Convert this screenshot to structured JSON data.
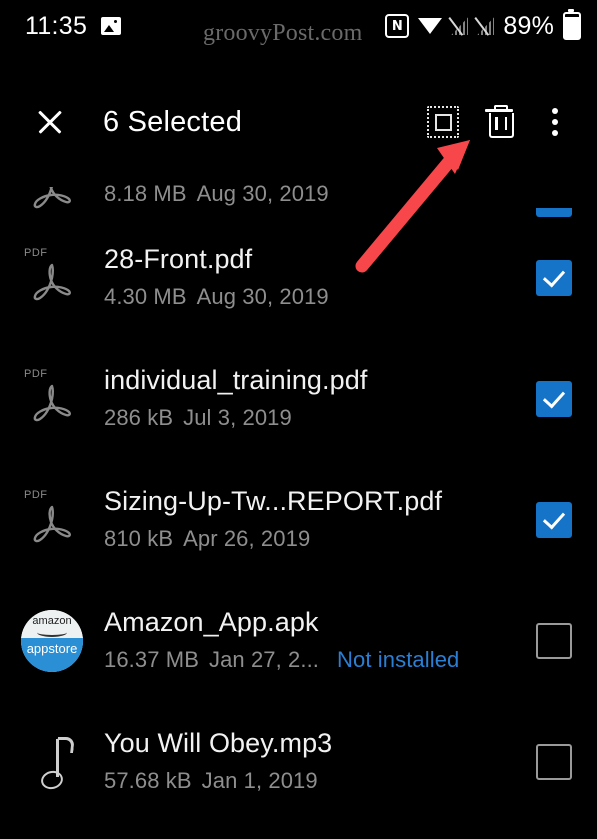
{
  "status_bar": {
    "clock": "11:35",
    "battery_percent": "89%",
    "icons": [
      "image-icon",
      "nfc-icon",
      "wifi-icon",
      "signal-off-icon",
      "signal-off-icon",
      "battery-icon"
    ]
  },
  "watermark": {
    "text": "groovyPost.com"
  },
  "toolbar": {
    "close_label": "",
    "title": "6 Selected",
    "actions": [
      {
        "name": "select-all-icon"
      },
      {
        "name": "delete-icon"
      },
      {
        "name": "overflow-menu-icon"
      }
    ]
  },
  "colors": {
    "background": "#000000",
    "accent_blue": "#1573c8",
    "link_blue": "#2a7fd4",
    "annotation_red": "#f7474b",
    "primary_text": "#f2f2f2",
    "secondary_text": "#8e8e8e"
  },
  "files": [
    {
      "name": "",
      "size": "8.18 MB",
      "date": "Aug 30, 2019",
      "status": "",
      "icon": "pdf-icon",
      "checked": true,
      "clipped": true
    },
    {
      "name": "28-Front.pdf",
      "size": "4.30 MB",
      "date": "Aug 30, 2019",
      "status": "",
      "icon": "pdf-icon",
      "checked": true,
      "clipped": false
    },
    {
      "name": "individual_training.pdf",
      "size": "286 kB",
      "date": "Jul 3, 2019",
      "status": "",
      "icon": "pdf-icon",
      "checked": true,
      "clipped": false
    },
    {
      "name": "Sizing-Up-Tw...REPORT.pdf",
      "size": "810 kB",
      "date": "Apr 26, 2019",
      "status": "",
      "icon": "pdf-icon",
      "checked": true,
      "clipped": false
    },
    {
      "name": "Amazon_App.apk",
      "size": "16.37 MB",
      "date": "Jan 27, 2...",
      "status": "Not installed",
      "icon": "amazon-appstore-icon",
      "checked": false,
      "clipped": false
    },
    {
      "name": "You Will Obey.mp3",
      "size": "57.68 kB",
      "date": "Jan 1, 2019",
      "status": "",
      "icon": "music-note-icon",
      "checked": false,
      "clipped": false
    }
  ],
  "annotation": {
    "type": "arrow",
    "points_to": "delete-icon"
  },
  "icon_glyphs": {
    "nfc": "N",
    "pdf_label": "PDF",
    "amazon_word": "amazon",
    "appstore_word": "appstore"
  }
}
